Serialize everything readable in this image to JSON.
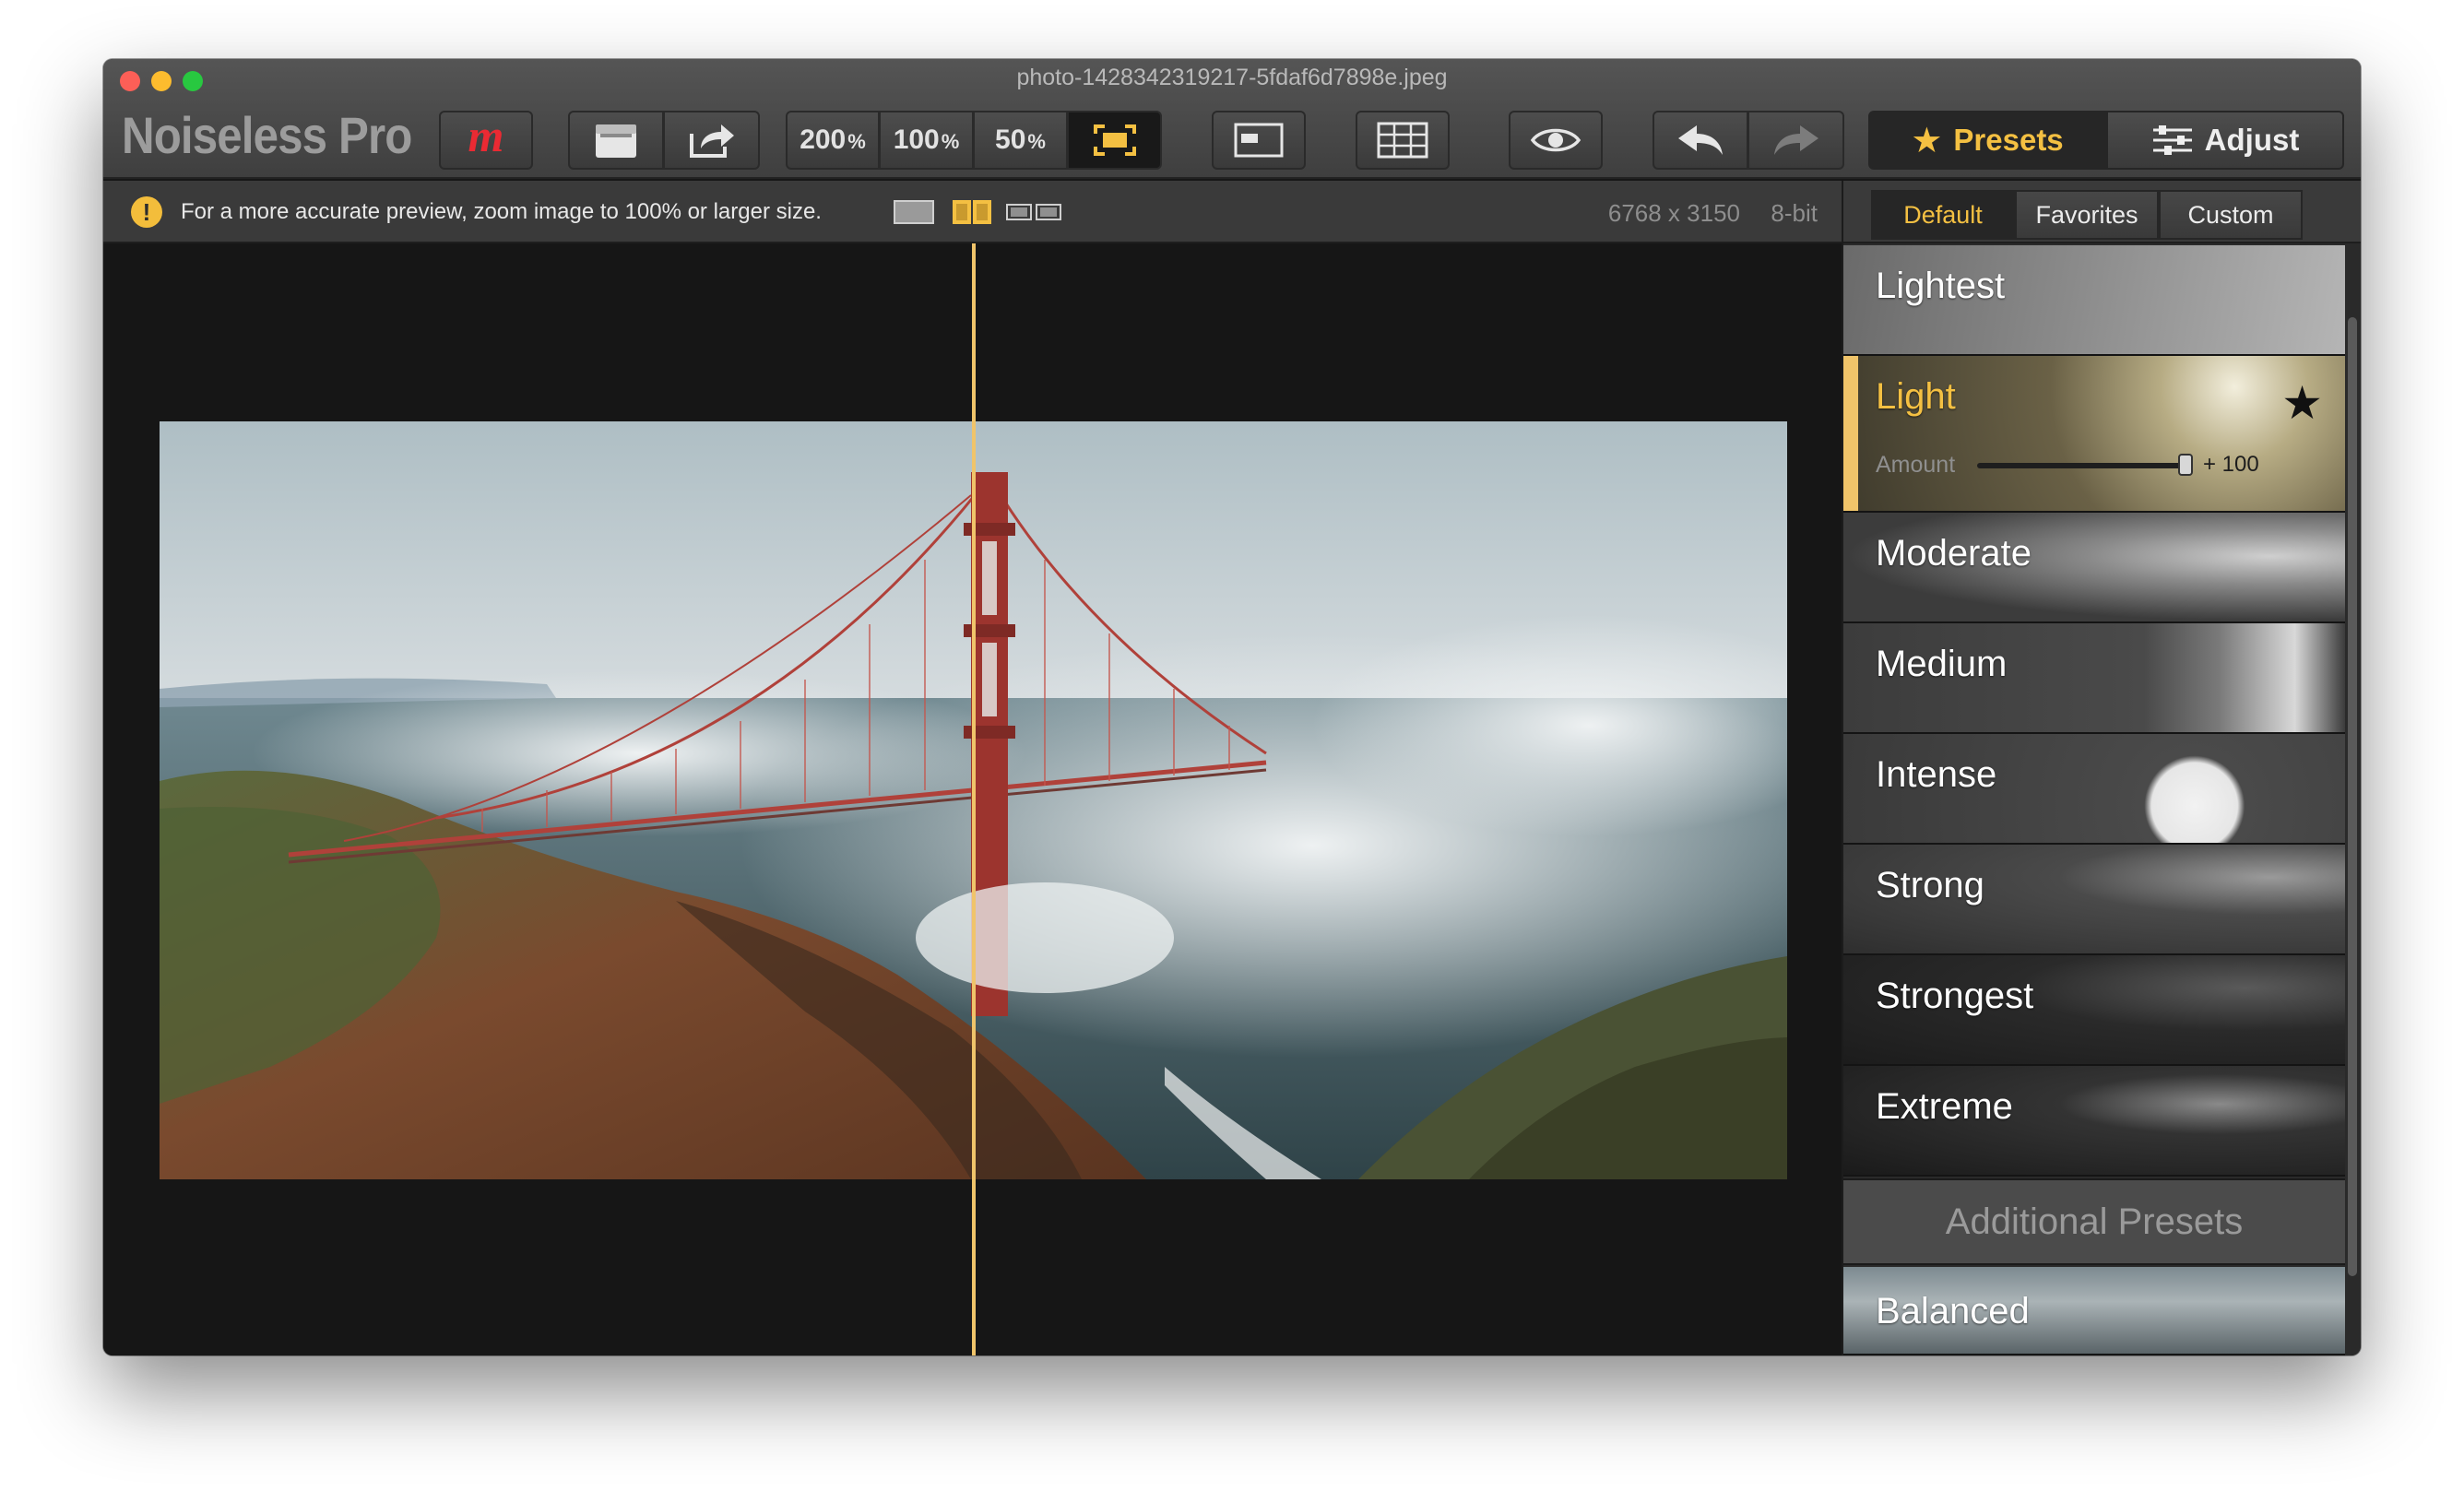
{
  "window": {
    "title": "photo-1428342319217-5fdaf6d7898e.jpeg"
  },
  "app": {
    "name": "Noiseless Pro",
    "logo_letter": "m"
  },
  "toolbar": {
    "zoom": [
      {
        "value": "200",
        "unit": "%"
      },
      {
        "value": "100",
        "unit": "%"
      },
      {
        "value": "50",
        "unit": "%"
      }
    ],
    "presets_label": "Presets",
    "adjust_label": "Adjust",
    "star_icon": "★"
  },
  "infobar": {
    "warning": "For a more accurate preview, zoom image to 100% or larger size.",
    "warning_glyph": "!",
    "dimensions": "6768 x 3150",
    "bit_depth": "8-bit"
  },
  "sidebar": {
    "tabs": [
      "Default",
      "Favorites",
      "Custom"
    ],
    "active_tab": "Default",
    "presets": [
      {
        "name": "Lightest"
      },
      {
        "name": "Light",
        "selected": true,
        "favorite": true
      },
      {
        "name": "Moderate"
      },
      {
        "name": "Medium"
      },
      {
        "name": "Intense"
      },
      {
        "name": "Strong"
      },
      {
        "name": "Strongest"
      },
      {
        "name": "Extreme"
      }
    ],
    "amount": {
      "label": "Amount",
      "value_text": "+ 100",
      "level": 1.0
    },
    "additional_header": "Additional Presets",
    "additional_presets": [
      {
        "name": "Balanced"
      }
    ],
    "fav_star": "★"
  },
  "colors": {
    "accent": "#f0c46a",
    "accent_text": "#f4c042",
    "logo_red": "#ea2a33"
  }
}
